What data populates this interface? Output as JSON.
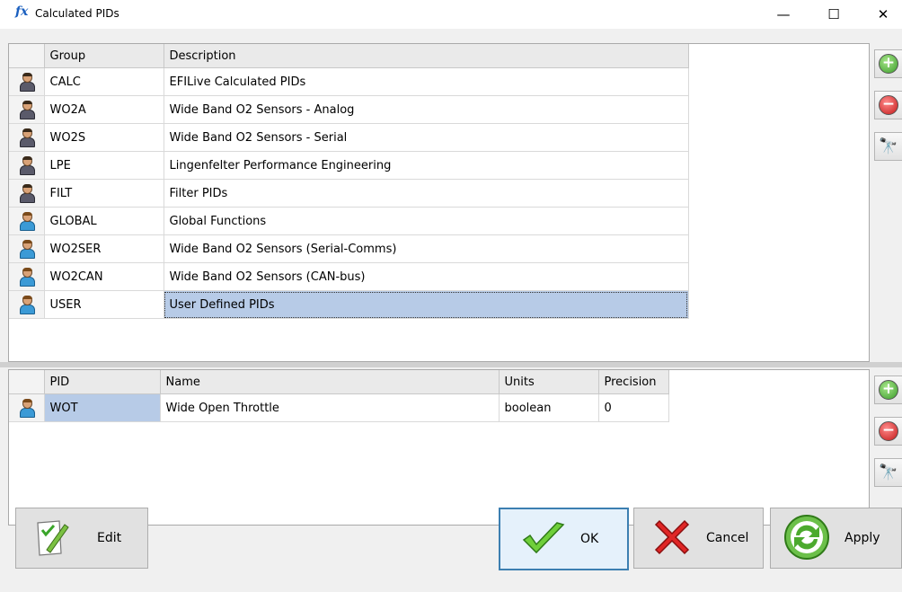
{
  "window": {
    "title": "Calculated PIDs",
    "title_icon": "fx"
  },
  "groups": {
    "columns": [
      "Group",
      "Description"
    ],
    "rows": [
      {
        "group": "CALC",
        "description": "EFILive Calculated PIDs",
        "kind": "system"
      },
      {
        "group": "WO2A",
        "description": "Wide Band O2 Sensors - Analog",
        "kind": "system"
      },
      {
        "group": "WO2S",
        "description": "Wide Band O2 Sensors - Serial",
        "kind": "system"
      },
      {
        "group": "LPE",
        "description": "Lingenfelter Performance Engineering",
        "kind": "system"
      },
      {
        "group": "FILT",
        "description": "Filter PIDs",
        "kind": "system"
      },
      {
        "group": "GLOBAL",
        "description": "Global Functions",
        "kind": "user"
      },
      {
        "group": "WO2SER",
        "description": "Wide Band O2 Sensors (Serial-Comms)",
        "kind": "user"
      },
      {
        "group": "WO2CAN",
        "description": "Wide Band O2 Sensors (CAN-bus)",
        "kind": "user"
      },
      {
        "group": "USER",
        "description": "User Defined PIDs",
        "kind": "user",
        "selected": true
      }
    ]
  },
  "pids": {
    "columns": [
      "PID",
      "Name",
      "Units",
      "Precision"
    ],
    "rows": [
      {
        "pid": "WOT",
        "name": "Wide Open Throttle",
        "units": "boolean",
        "precision": "0"
      }
    ]
  },
  "side_icons": [
    "add-icon",
    "remove-icon",
    "binoculars-icon"
  ],
  "buttons": {
    "edit": "Edit",
    "ok": "OK",
    "cancel": "Cancel",
    "apply": "Apply"
  },
  "colors": {
    "selection": "#b7cbe7",
    "ok_border": "#3c7fb1"
  }
}
